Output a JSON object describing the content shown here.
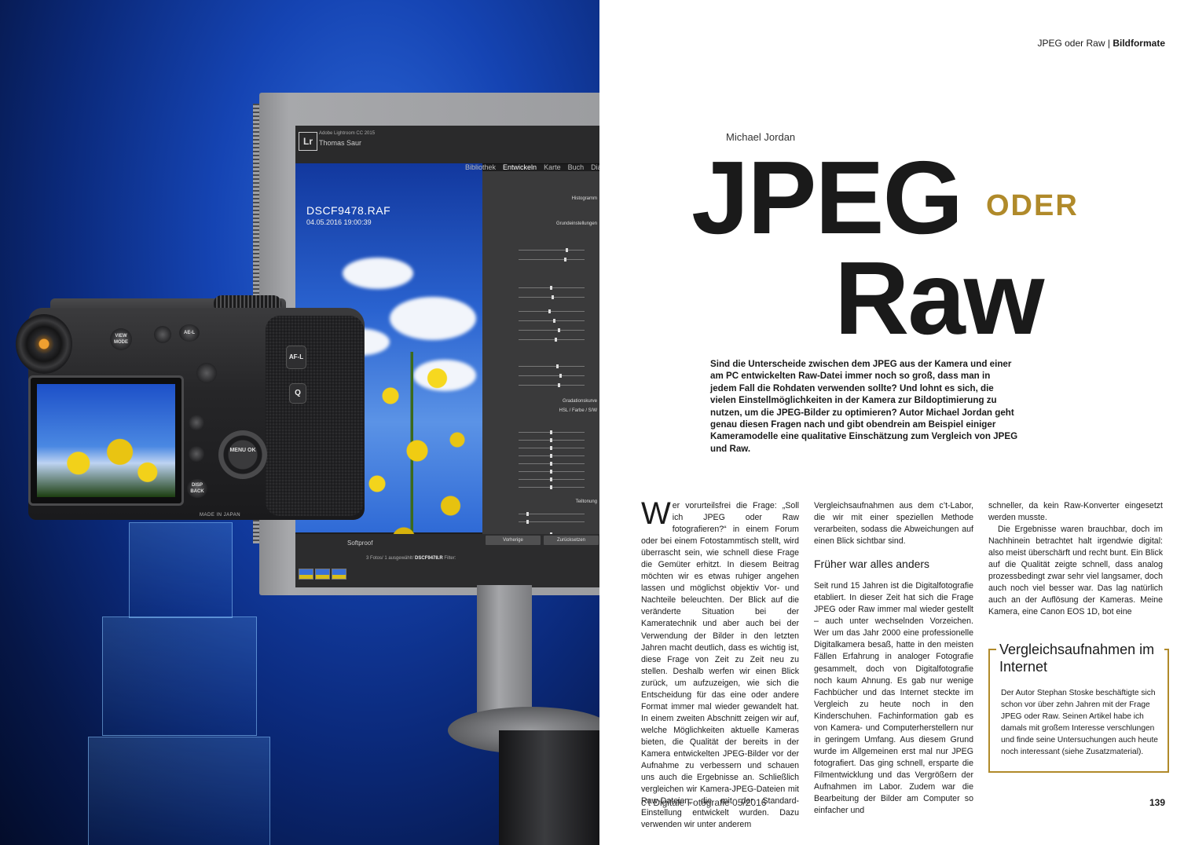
{
  "header": {
    "section": "JPEG oder Raw",
    "separator": "|",
    "category": "Bildformate"
  },
  "article": {
    "author": "Michael Jordan",
    "title_part1": "JPEG",
    "title_part2": "ODER",
    "title_part3": "Raw",
    "lead": "Sind die Unterscheide zwischen dem JPEG aus der Kamera und einer am PC entwickelten Raw-Datei immer noch so groß, dass man in jedem Fall die Rohdaten verwenden sollte? Und lohnt es sich, die vielen Einstellmöglichkeiten in der Kamera zur Bildoptimierung zu nutzen, um die JPEG-Bilder zu optimieren? Autor Michael Jordan geht genau diesen Fragen nach und gibt obendrein am Beispiel einiger Kameramodelle eine qualitative Einschätzung zum Vergleich von JPEG und Raw.",
    "dropcap": "W",
    "col1": "er vorurteilsfrei die Frage: „Soll ich JPEG oder Raw fotografieren?“ in einem Forum oder bei einem Fotostammtisch stellt, wird überrascht sein, wie schnell diese Frage die Gemüter erhitzt. In diesem Beitrag möchten wir es etwas ruhiger angehen lassen und möglichst objektiv Vor- und Nachteile beleuchten. Der Blick auf die veränderte Situation bei der Kameratechnik und aber auch bei der Verwendung der Bilder in den letzten Jahren macht deutlich, dass es wichtig ist, diese Frage von Zeit zu Zeit neu zu stellen. Deshalb werfen wir einen Blick zurück, um aufzuzeigen, wie sich die Entscheidung für das eine oder andere Format immer mal wieder gewandelt hat. In einem zweiten Abschnitt zeigen wir auf, welche Möglichkeiten aktuelle Kameras bieten, die Qualität der bereits in der Kamera entwickelten JPEG-Bilder vor der Aufnahme zu verbessern und schauen uns auch die Ergebnisse an. Schließlich vergleichen wir Kamera-JPEG-Dateien mit Raw-Dateien, die mit der Standard-Einstellung entwickelt wurden. Dazu verwenden wir unter anderem",
    "col2_intro": "Vergleichsaufnahmen aus dem c’t-Labor, die wir mit einer speziellen Methode verarbeiten, sodass die Abweichungen auf einen Blick sichtbar sind.",
    "subhead": "Früher war alles anders",
    "col2_body": "Seit rund 15 Jahren ist die Digitalfotografie etabliert. In dieser Zeit hat sich die Frage JPEG oder Raw immer mal wieder gestellt – auch unter wechselnden Vorzeichen. Wer um das Jahr 2000 eine professionelle Digitalkamera besaß, hatte in den meisten Fällen Erfahrung in analoger Fotografie gesammelt, doch von Digitalfotografie noch kaum Ahnung. Es gab nur wenige Fachbücher und das Internet steckte im Vergleich zu heute noch in den Kinderschuhen. Fachinformation gab es von Kamera- und Computerherstellern nur in geringem Umfang. Aus diesem Grund wurde im Allgemeinen erst mal nur JPEG fotografiert. Das ging schnell, ersparte die Filmentwicklung und das Vergrößern der Aufnahmen im Labor. Zudem war die Bearbeitung der Bilder am Computer so einfacher und",
    "col3_p1": "schneller, da kein Raw-Konverter eingesetzt werden musste.",
    "col3_p2": "Die Ergebnisse waren brauchbar, doch im Nachhinein betrachtet halt irgendwie digital: also meist überschärft und recht bunt. Ein Blick auf die Qualität zeigte schnell, dass analog prozessbedingt zwar sehr viel langsamer, doch auch noch viel besser war. Das lag natürlich auch an der Auflösung der Kameras. Meine Kamera, eine Canon EOS 1D, bot eine"
  },
  "sidebar_box": {
    "title": "Vergleichsaufnahmen im Internet",
    "text": "Der Autor Stephan Stoske beschäftigte sich schon vor über zehn Jahren mit der Frage JPEG oder Raw. Seinen Artikel habe ich damals mit großem Interesse verschlungen und finde seine Untersuchungen auch heute noch interessant (siehe Zusatzmaterial)."
  },
  "footer": {
    "publication": "c’t Digitale Fotografie 05/2016",
    "page_number": "139"
  },
  "photo": {
    "lr_logo": "Lr",
    "lr_app": "Adobe Lightroom CC 2015",
    "lr_user": "Thomas Saur",
    "lr_modules": [
      "Bibliothek",
      "Entwickeln",
      "Karte",
      "Buch",
      "Diashow"
    ],
    "file_name": "DSCF9478.RAF",
    "file_date": "04.05.2016 19:00:39",
    "panel_histogram": "Histogramm",
    "panel_basic": "Grundeinstellungen",
    "panel_tone": "Gradationskurve",
    "panel_hsl": "HSL / Farbe / S/W",
    "panel_split": "Teiltonung",
    "softproof": "Softproof",
    "fotos_text": "3 Fotos/ 1 ausgewählt/",
    "fotos_file": "DSCF9478.R",
    "filter_label": "Filter:",
    "btn_vorher": "Vorherige",
    "btn_zurueck": "Zurücksetzen",
    "made_in": "MADE IN JAPAN",
    "btn_afl": "AF-L",
    "btn_q": "Q",
    "btn_menu": "MENU OK",
    "btn_disp": "DISP BACK",
    "btn_view": "VIEW MODE",
    "btn_ael": "AE-L",
    "accent": "#b08a2a"
  }
}
